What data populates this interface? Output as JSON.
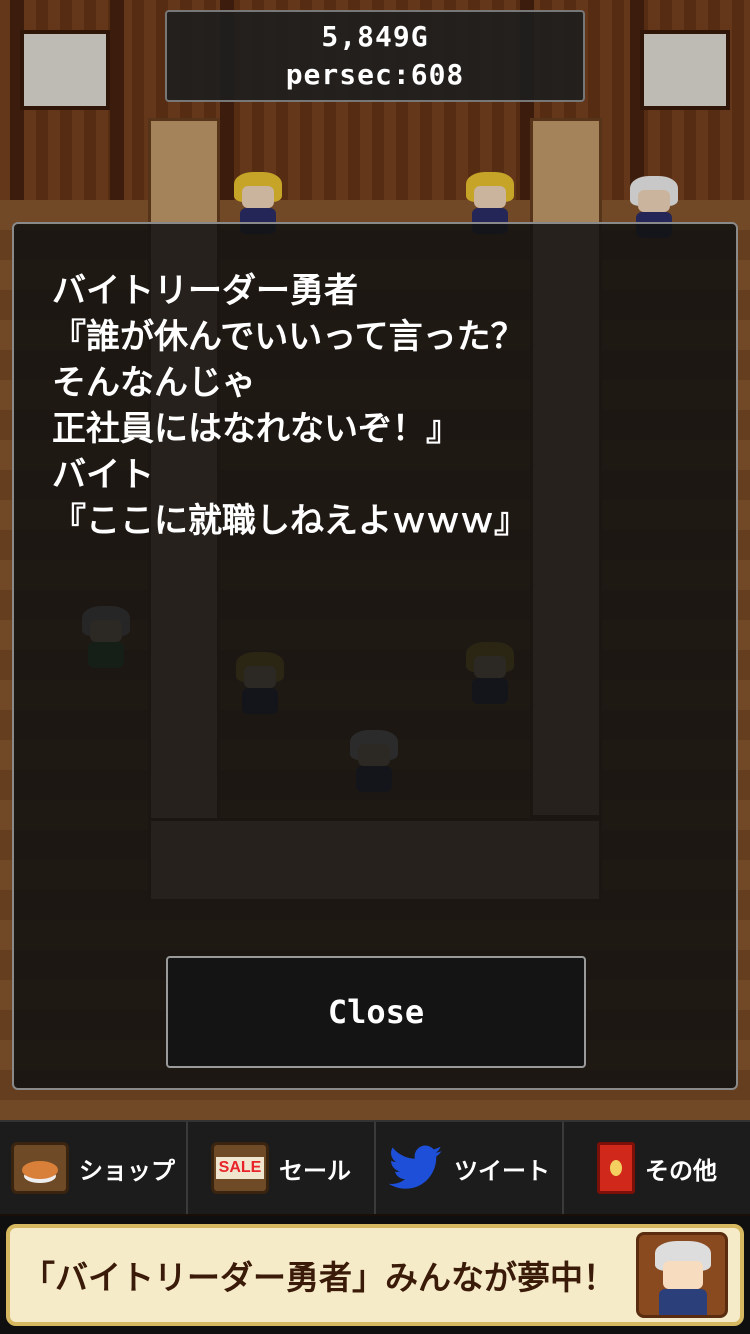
{
  "hud": {
    "gold": "5,849G",
    "per_second": "persec:608"
  },
  "dialog": {
    "lines": [
      "バイトリーダー勇者",
      "『誰が休んでいいって言った？",
      "そんなんじゃ",
      "正社員にはなれないぞ！』",
      "バイト",
      "『ここに就職しねえよｗｗｗ』"
    ],
    "close_label": "Close"
  },
  "nav": {
    "items": [
      {
        "label": "ショップ",
        "icon": "food-plate-icon"
      },
      {
        "label": "セール",
        "icon": "sale-sign-icon",
        "icon_text": "SALE"
      },
      {
        "label": "ツイート",
        "icon": "twitter-bird-icon"
      },
      {
        "label": "その他",
        "icon": "red-book-icon"
      }
    ]
  },
  "banner": {
    "text": "「バイトリーダー勇者」みんなが夢中！"
  },
  "colors": {
    "dialog_bg": "#121212",
    "banner_bg": "#f6ebc8",
    "twitter_blue": "#1d4fd8"
  }
}
